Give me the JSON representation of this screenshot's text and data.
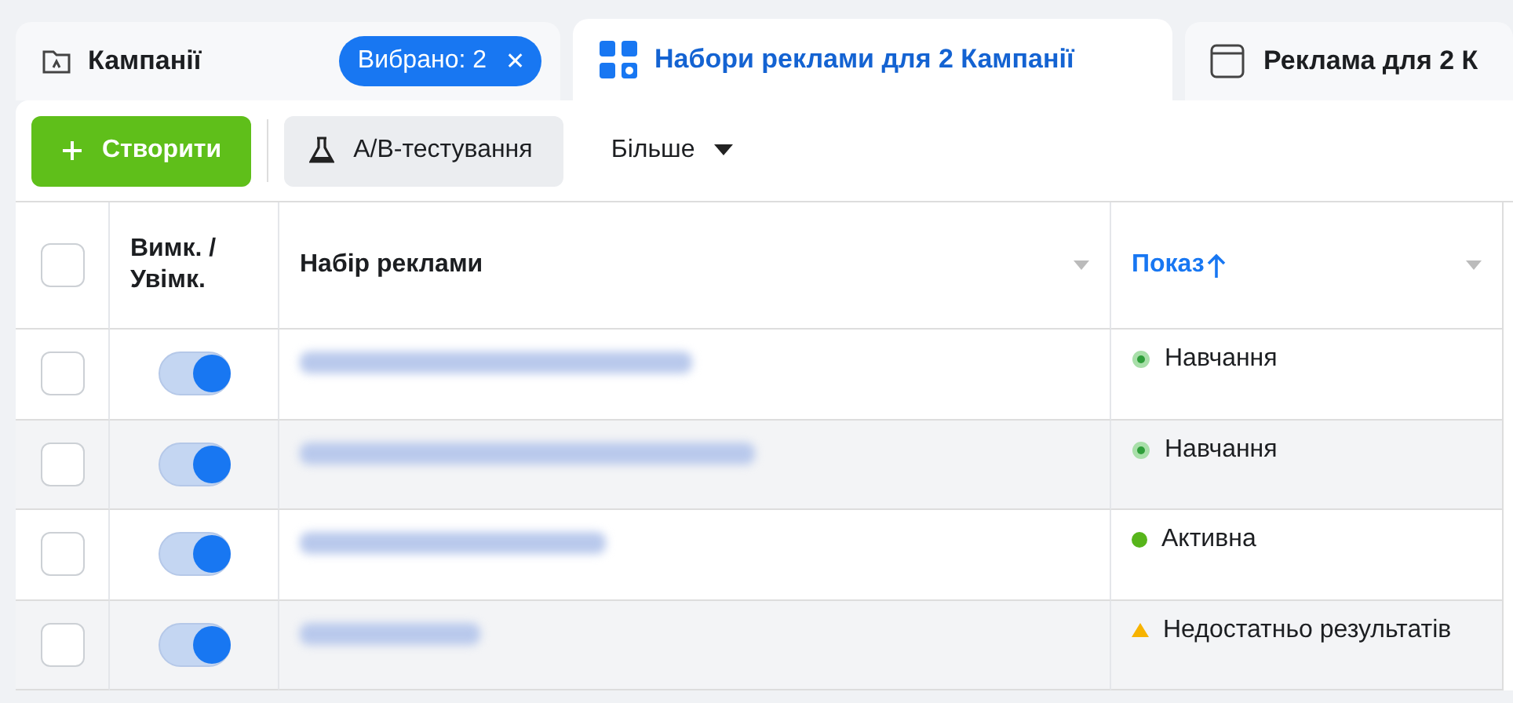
{
  "tabs": [
    {
      "kind": "campaigns",
      "label": "Кампанії",
      "selected": false,
      "badge": "Вибрано: 2",
      "badge_close": "✕"
    },
    {
      "kind": "adsets",
      "label": "Набори реклами для 2 Кампанії",
      "selected": true
    },
    {
      "kind": "ads",
      "label": "Реклама для 2 К",
      "selected": false
    }
  ],
  "toolbar": {
    "create": "Створити",
    "ab_test": "A/B-тестування",
    "more": "Більше"
  },
  "table": {
    "columns": [
      "Вимк. / Увімк.",
      "Набір реклами",
      "Показ"
    ],
    "header_checked": false,
    "rows": [
      {
        "checked": false,
        "on": true,
        "status": {
          "kind": "learning",
          "label": "Навчання"
        }
      },
      {
        "checked": false,
        "on": true,
        "status": {
          "kind": "learning",
          "label": "Навчання"
        }
      },
      {
        "checked": false,
        "on": true,
        "status": {
          "kind": "active",
          "label": "Активна"
        }
      },
      {
        "checked": false,
        "on": true,
        "status": {
          "kind": "warning",
          "label": "Недостатньо результатів"
        }
      }
    ]
  }
}
